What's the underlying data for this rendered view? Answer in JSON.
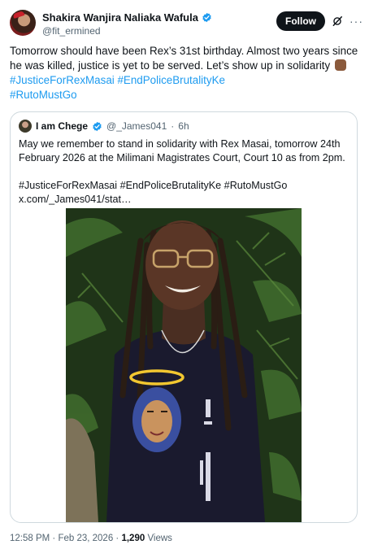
{
  "author": {
    "display_name": "Shakira Wanjira Naliaka Wafula",
    "handle": "@fit_ermined",
    "verified": true
  },
  "actions": {
    "follow_label": "Follow",
    "grok_icon": "grok-icon",
    "more_icon": "more-icon"
  },
  "tweet": {
    "text": "Tomorrow should have been Rex’s 31st birthday. Almost two years since he was killed, justice is yet to be served. Let’s show up in solidarity",
    "emoji": "raised-fist-emoji",
    "hashtags_line1": "#JusticeForRexMasai #EndPoliceBrutalityKe",
    "hashtags_line2": "#RutoMustGo"
  },
  "quote": {
    "display_name": "I am Chege",
    "handle": "@_James041",
    "separator": "·",
    "time": "6h",
    "verified": true,
    "text": "May we remember to stand in solidarity with Rex Masai, tomorrow 24th February 2026 at the Milimani Magistrates Court, Court 10 as from 2pm.",
    "hashtags": "#JusticeForRexMasai #EndPoliceBrutalityKe #RutoMustGo",
    "link": "x.com/_James041/stat…"
  },
  "footer": {
    "timestamp": "12:58 PM · Feb 23, 2026 ·",
    "views_count": "1,290",
    "views_label": "Views"
  },
  "colors": {
    "accent": "#1d9bf0",
    "text": "#0f1419",
    "muted": "#536471",
    "border": "#cfd9de"
  }
}
